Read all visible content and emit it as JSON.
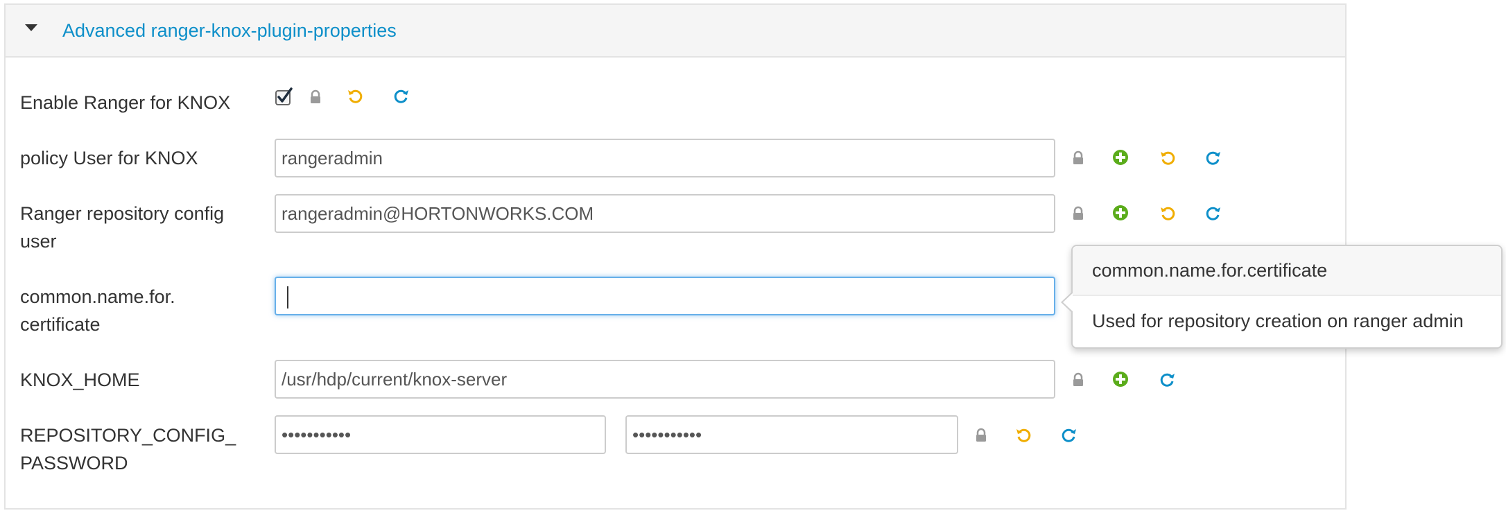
{
  "section": {
    "title": "Advanced ranger-knox-plugin-properties"
  },
  "colors": {
    "link": "#0d8fc9",
    "lock": "#9a9a9a",
    "add": "#5bac1b",
    "undo": "#f0ad00",
    "refresh": "#0d8fc9"
  },
  "icons": {
    "lock": "lock-icon",
    "add": "plus-circle-icon",
    "undo": "undo-icon",
    "refresh": "refresh-icon",
    "collapse": "caret-down-icon",
    "checkbox": "checkbox-checked-icon"
  },
  "rows": {
    "enable_ranger": {
      "label": "Enable Ranger for KNOX",
      "checked": true
    },
    "policy_user": {
      "label": "policy User for KNOX",
      "value": "rangeradmin"
    },
    "repo_config_user": {
      "label_line1": "Ranger repository config",
      "label_line2": "user",
      "value": "rangeradmin@HORTONWORKS.COM"
    },
    "common_name": {
      "label_line1": "common.name.for.",
      "label_line2": "certificate",
      "value": ""
    },
    "knox_home": {
      "label": "KNOX_HOME",
      "value": "/usr/hdp/current/knox-server"
    },
    "repo_password": {
      "label_line1": "REPOSITORY_CONFIG_",
      "label_line2": "PASSWORD",
      "value": "•••••••••••",
      "confirm_value": "•••••••••••"
    }
  },
  "tooltip": {
    "title": "common.name.for.certificate",
    "body": "Used for repository creation on ranger admin"
  }
}
